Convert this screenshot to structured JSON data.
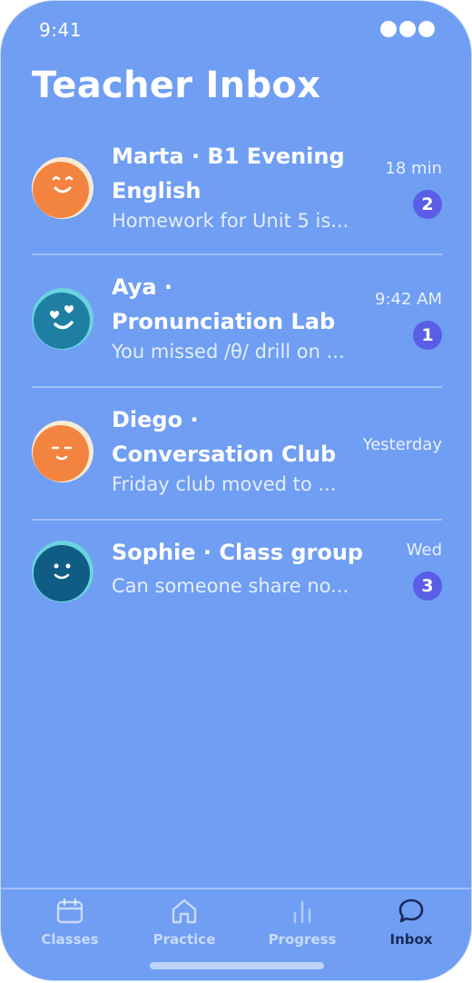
{
  "status_bar": {
    "time": "9:41"
  },
  "header": {
    "title": "Teacher Inbox"
  },
  "threads": [
    {
      "name": "Marta · B1 Evening English",
      "preview": "Homework for Unit 5 is...",
      "time": "18 min",
      "unread": "2",
      "avatar": "smiling-face-icon",
      "avatar_color": "#f3843f"
    },
    {
      "name": "Aya · Pronunciation Lab",
      "preview": "You missed /θ/ drill on ...",
      "time": "9:42 AM",
      "unread": "1",
      "avatar": "heart-eyes-face-icon",
      "avatar_color": "#1f7fa3"
    },
    {
      "name": "Diego · Conversation Club",
      "preview": "Friday club moved to ...",
      "time": "Yesterday",
      "unread": null,
      "avatar": "content-face-icon",
      "avatar_color": "#f3843f"
    },
    {
      "name": "Sophie · Class group",
      "preview": "Can someone share no...",
      "time": "Wed",
      "unread": "3",
      "avatar": "calm-face-icon",
      "avatar_color": "#0f5c85"
    }
  ],
  "tabbar": {
    "tabs": [
      {
        "label": "Classes",
        "icon": "calendar-icon",
        "active": false
      },
      {
        "label": "Practice",
        "icon": "home-icon",
        "active": false
      },
      {
        "label": "Progress",
        "icon": "bar-chart-icon",
        "active": false
      },
      {
        "label": "Inbox",
        "icon": "chat-bubble-icon",
        "active": true
      }
    ]
  },
  "colors": {
    "background": "#6f9ef3",
    "badge": "#5a5ee6",
    "avatar_orange": "#f3843f",
    "avatar_teal": "#1f7fa3",
    "avatar_navy": "#0f5c85",
    "active_tab": "#1b2a58"
  }
}
